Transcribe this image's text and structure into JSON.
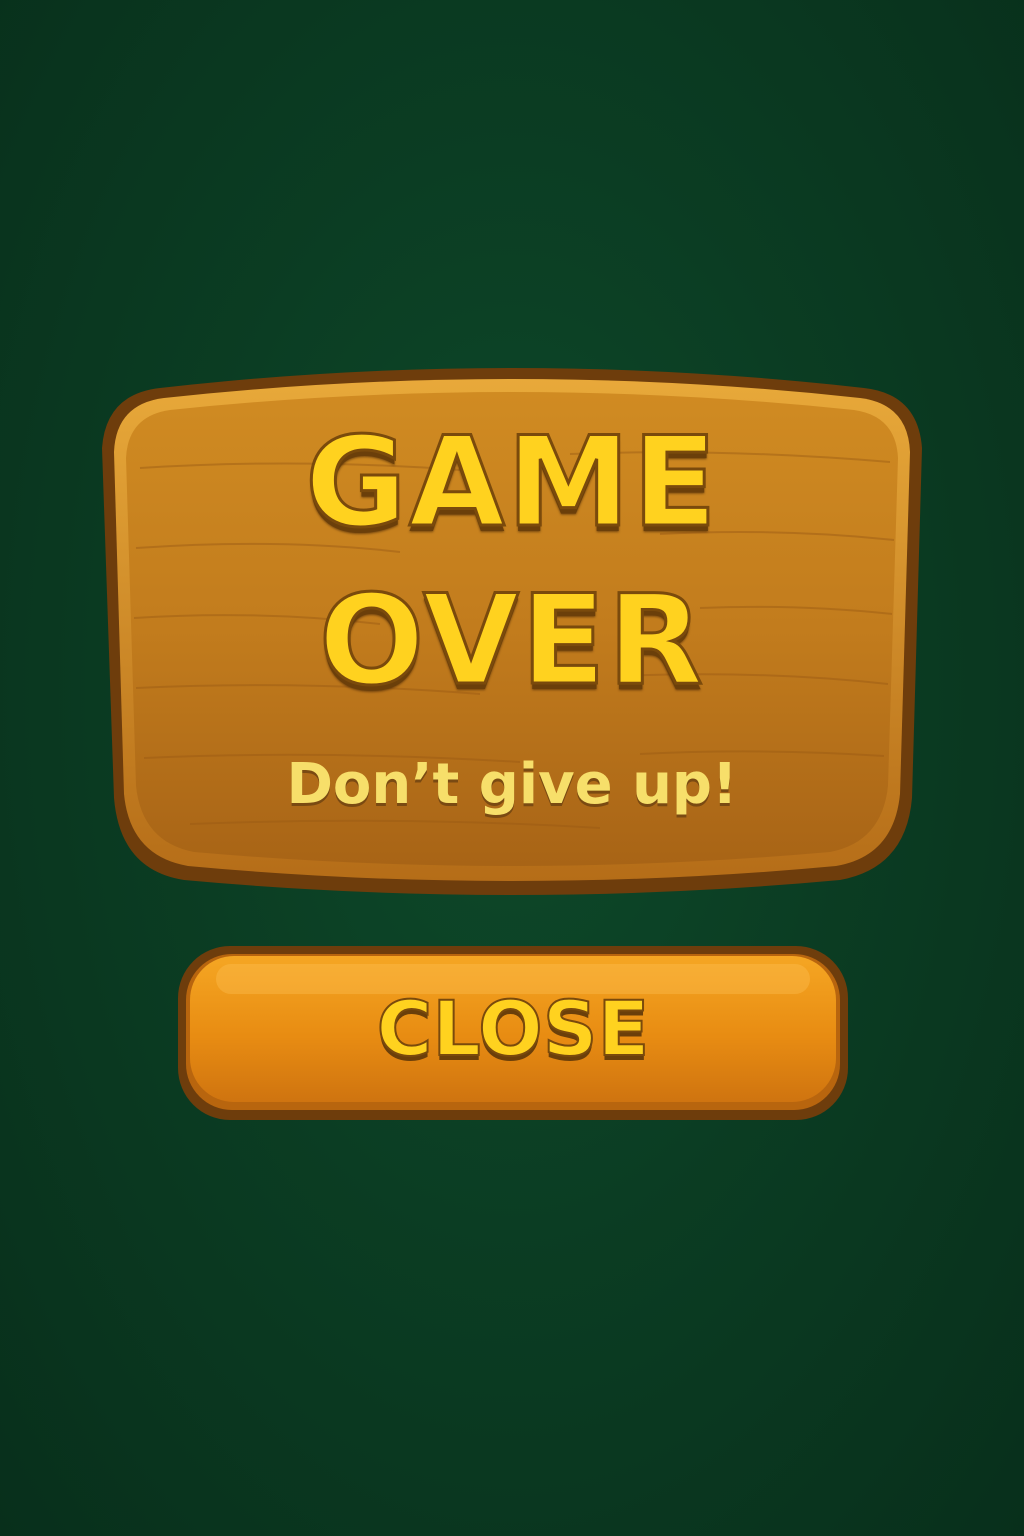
{
  "dialog": {
    "title_line_1": "GAME",
    "title_line_2": "OVER",
    "subtitle": "Don’t give up!"
  },
  "buttons": {
    "close_label": "CLOSE"
  },
  "colors": {
    "background": "#0b3d23",
    "sign_wood": "#c47f1c",
    "sign_border": "#6e3d0c",
    "title_text": "#ffd21f",
    "subtitle_text": "#f7df6a",
    "button_fill": "#e88c12"
  }
}
